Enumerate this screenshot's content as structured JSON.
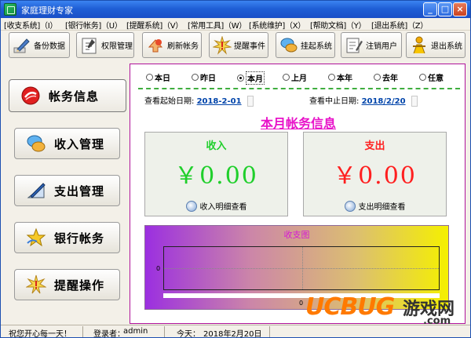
{
  "window": {
    "title": "家庭理财专家",
    "minimize": "_",
    "maximize": "□",
    "close": "×"
  },
  "menu": [
    "[收支系统]（I）",
    "[银行帐务]（U）",
    "[提醒系统]（V）",
    "[常用工具]（W）",
    "[系统维护]（X）",
    "[帮助文档]（Y）",
    "[退出系统]（Z）"
  ],
  "toolbar": [
    {
      "label": "备份数据",
      "icon": "pen-icon"
    },
    {
      "label": "权限管理",
      "icon": "key-icon"
    },
    {
      "label": "刷新帐务",
      "icon": "refresh-icon"
    },
    {
      "label": "提醒事件",
      "icon": "star-burst-icon"
    },
    {
      "label": "挂起系统",
      "icon": "chat-bubble-icon"
    },
    {
      "label": "注销用户",
      "icon": "user-pen-icon"
    },
    {
      "label": "退出系统",
      "icon": "person-icon"
    }
  ],
  "nav": [
    {
      "label": "帐务信息",
      "icon": "ledger-icon",
      "active": true
    },
    {
      "label": "收入管理",
      "icon": "chat-bubble-icon",
      "active": false
    },
    {
      "label": "支出管理",
      "icon": "pen-chart-icon",
      "active": false
    },
    {
      "label": "银行帐务",
      "icon": "star-icon",
      "active": false
    },
    {
      "label": "提醒操作",
      "icon": "burst-icon",
      "active": false
    }
  ],
  "periods": [
    {
      "label": "本日",
      "selected": false
    },
    {
      "label": "昨日",
      "selected": false
    },
    {
      "label": "本月",
      "selected": true
    },
    {
      "label": "上月",
      "selected": false
    },
    {
      "label": "本年",
      "selected": false
    },
    {
      "label": "去年",
      "selected": false
    },
    {
      "label": "任意",
      "selected": false
    }
  ],
  "dates": {
    "start_label": "查看起始日期:",
    "start_value": "2018-2-01",
    "end_label": "查看中止日期:",
    "end_value": "2018/2/20"
  },
  "panel_title": "本月帐务信息",
  "income": {
    "title": "收入",
    "amount": "￥0.00",
    "link": "收入明细查看",
    "color": "#1fcf2b"
  },
  "expense": {
    "title": "支出",
    "amount": "￥0.00",
    "link": "支出明细查看",
    "color": "#ff1f1f"
  },
  "chart": {
    "title": "收支图",
    "ytick": "0",
    "xtick": "0"
  },
  "status": {
    "greeting": "祝您开心每一天！",
    "login_label": "登录者：",
    "user": "admin",
    "today_label": "今天：",
    "today": "2018年2月20日"
  },
  "watermark": {
    "brand": "UCBUG",
    "cn": "游戏网",
    "domain": ".com"
  },
  "colors": {
    "accent": "#b0139a",
    "title_pink": "#e812c9",
    "watermark_orange": "#ff7a00"
  }
}
